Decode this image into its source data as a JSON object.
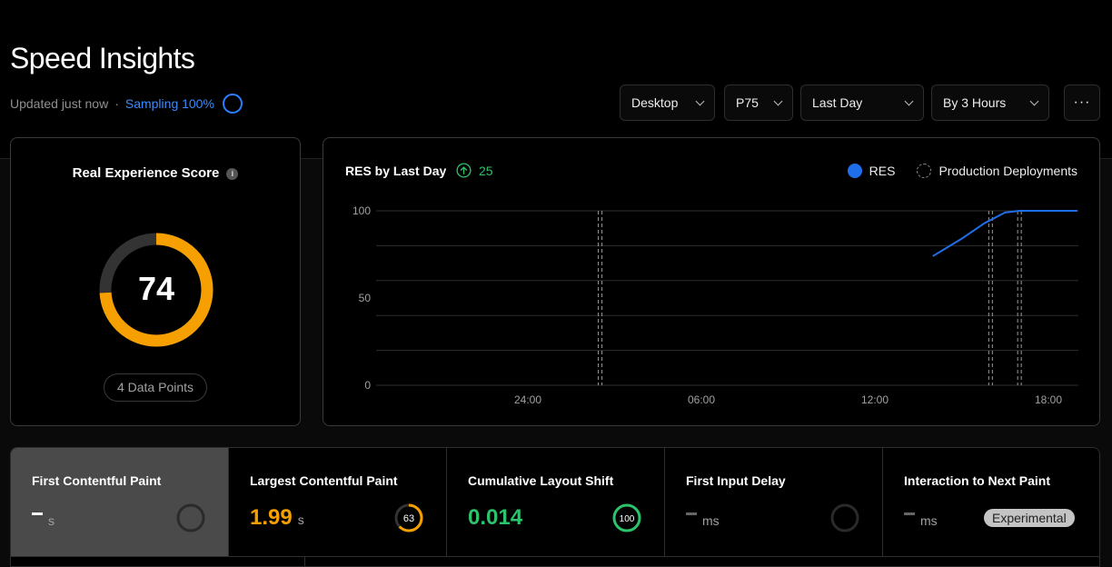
{
  "header": {
    "title": "Speed Insights",
    "updated": "Updated just now",
    "separator": "·",
    "sampling": "Sampling 100%"
  },
  "filters": {
    "device": "Desktop",
    "percentile": "P75",
    "range": "Last Day",
    "granularity": "By 3 Hours",
    "more": "···"
  },
  "score": {
    "title": "Real Experience Score",
    "info": "i",
    "value": 74,
    "value_label": "74",
    "data_points": "4 Data Points",
    "color": "#f5a000"
  },
  "chart": {
    "title": "RES by Last Day",
    "trend": "25",
    "legend_res": "RES",
    "legend_deploy": "Production Deployments"
  },
  "chart_data": {
    "type": "line",
    "title": "RES by Last Day",
    "ylim": [
      0,
      100
    ],
    "yticks": [
      0,
      50,
      100
    ],
    "xticks": [
      "24:00",
      "06:00",
      "12:00",
      "18:00"
    ],
    "x_hours": [
      14.0,
      15.25,
      16.8,
      17.1,
      18.5,
      19.0
    ],
    "series": [
      {
        "name": "RES",
        "color": "#1f6feb",
        "x": [
          14.0,
          15.0,
          15.8,
          16.5,
          17.0,
          19.0
        ],
        "values": [
          74,
          84,
          93,
          99,
          100,
          100
        ]
      }
    ],
    "deployments": [
      2.5,
      16.0,
      17.0
    ],
    "grid": true
  },
  "metrics": [
    {
      "title": "First Contentful Paint",
      "unit": "s",
      "ring": null
    },
    {
      "title": "Largest Contentful Paint",
      "value": "1.99",
      "unit": "s",
      "ring": "63",
      "ring_value": 63,
      "color": "#f5a000"
    },
    {
      "title": "Cumulative Layout Shift",
      "value": "0.014",
      "ring": "100",
      "ring_value": 100,
      "color": "#2cc36b"
    },
    {
      "title": "First Input Delay",
      "unit": "ms",
      "ring": null
    },
    {
      "title": "Interaction to Next Paint",
      "unit": "ms",
      "badge": "Experimental",
      "ring": null
    }
  ]
}
